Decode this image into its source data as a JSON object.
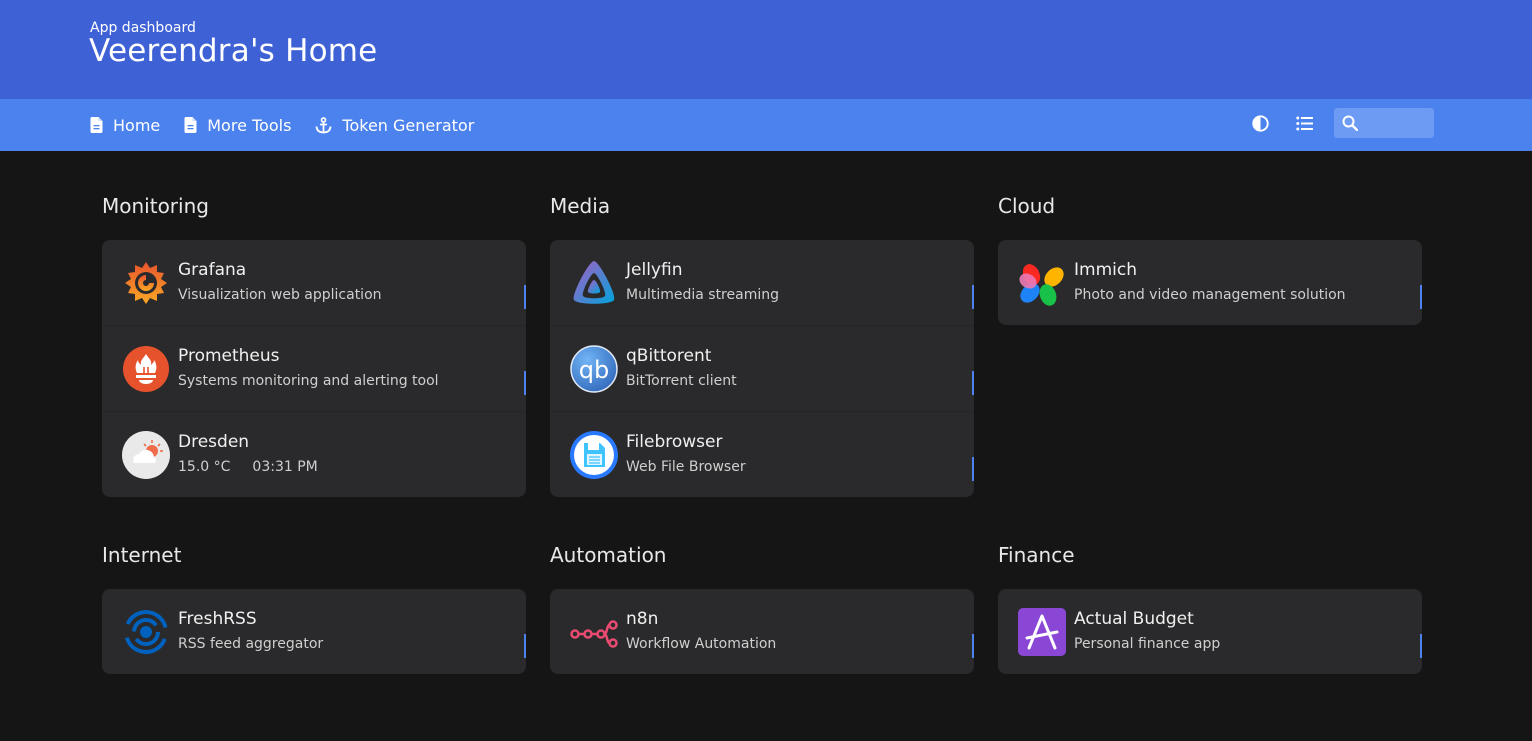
{
  "header": {
    "subtitle": "App dashboard",
    "title": "Veerendra's Home"
  },
  "nav": {
    "links": [
      {
        "label": "Home",
        "icon": "file-icon"
      },
      {
        "label": "More Tools",
        "icon": "file-icon"
      },
      {
        "label": "Token Generator",
        "icon": "anchor-icon"
      }
    ],
    "theme_icon": "contrast-icon",
    "layout_icon": "list-icon",
    "search_icon": "search-icon",
    "search_value": ""
  },
  "colors": {
    "header": "#3e62d6",
    "navbar": "#4c82ee",
    "background": "#151516",
    "card": "#2a2a2c"
  },
  "groups": [
    {
      "title": "Monitoring",
      "items": [
        {
          "name": "Grafana",
          "desc": "Visualization web application",
          "icon": "grafana-icon"
        },
        {
          "name": "Prometheus",
          "desc": "Systems monitoring and alerting tool",
          "icon": "prometheus-icon"
        },
        {
          "name": "Dresden",
          "temp": "15.0 °C",
          "time": "03:31 PM",
          "icon": "weather-icon"
        }
      ]
    },
    {
      "title": "Media",
      "items": [
        {
          "name": "Jellyfin",
          "desc": "Multimedia streaming",
          "icon": "jellyfin-icon"
        },
        {
          "name": "qBittorent",
          "desc": "BitTorrent client",
          "icon": "qbittorrent-icon"
        },
        {
          "name": "Filebrowser",
          "desc": "Web File Browser",
          "icon": "filebrowser-icon"
        }
      ]
    },
    {
      "title": "Cloud",
      "items": [
        {
          "name": "Immich",
          "desc": "Photo and video management solution",
          "icon": "immich-icon"
        }
      ]
    },
    {
      "title": "Internet",
      "items": [
        {
          "name": "FreshRSS",
          "desc": "RSS feed aggregator",
          "icon": "freshrss-icon"
        }
      ]
    },
    {
      "title": "Automation",
      "items": [
        {
          "name": "n8n",
          "desc": "Workflow Automation",
          "icon": "n8n-icon"
        }
      ]
    },
    {
      "title": "Finance",
      "items": [
        {
          "name": "Actual Budget",
          "desc": "Personal finance app",
          "icon": "actual-budget-icon"
        }
      ]
    }
  ]
}
